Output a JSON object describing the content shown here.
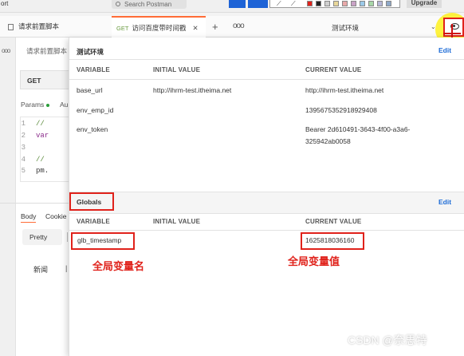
{
  "topbar": {
    "left_label": "ort",
    "search_placeholder": "Search Postman",
    "upgrade_label": "Upgrade",
    "swatch_colors": [
      "#e0221b",
      "#222222",
      "#cfcfcf",
      "#e8d79a",
      "#e8a9a9",
      "#c9a2c6",
      "#9bc9e8",
      "#a8d7a8",
      "#b8b8d8",
      "#8fa8c8"
    ]
  },
  "tabs": [
    {
      "label": "请求前置脚本",
      "method": ""
    },
    {
      "label": "访问百度带时间戳",
      "method": "GET"
    }
  ],
  "environment": {
    "selected": "测试环境"
  },
  "request": {
    "name_placeholder": "请求前置脚本",
    "method": "GET",
    "tabs": [
      "Params",
      "Au"
    ],
    "code_lines": [
      {
        "num": "1",
        "text": "//"
      },
      {
        "num": "2",
        "text": "var"
      },
      {
        "num": "3",
        "text": ""
      },
      {
        "num": "4",
        "text": "//"
      },
      {
        "num": "5",
        "text": "pm."
      }
    ],
    "response_tabs": [
      "Body",
      "Cookie"
    ],
    "pretty_label": "Pretty",
    "news_label": "新闻"
  },
  "popover": {
    "env_name": "测试环境",
    "edit_label": "Edit",
    "columns": {
      "variable": "VARIABLE",
      "initial": "INITIAL VALUE",
      "current": "CURRENT VALUE"
    },
    "env_vars": [
      {
        "variable": "base_url",
        "initial": "http://ihrm-test.itheima.net",
        "current": "http://ihrm-test.itheima.net"
      },
      {
        "variable": "env_emp_id",
        "initial": "",
        "current": "1395675352918929408"
      },
      {
        "variable": "env_token",
        "initial": "",
        "current_line1": "Bearer 2d610491-3643-4f00-a3a6-",
        "current_line2": "325942ab0058"
      }
    ],
    "globals_title": "Globals",
    "globals_vars": [
      {
        "variable": "glb_timestamp",
        "initial": "",
        "current": "1625818036160"
      }
    ]
  },
  "annotations": {
    "name_note": "全局变量名",
    "value_note": "全局变量值"
  },
  "watermark": "CSDN @奈思特",
  "colors": {
    "accent": "#ff6c37",
    "link": "#1c6bd6",
    "annotation_red": "#e0221b"
  }
}
